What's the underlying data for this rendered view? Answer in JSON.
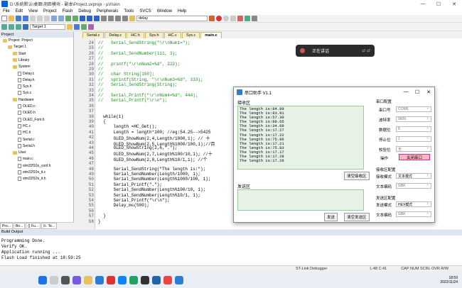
{
  "app": {
    "title": "D:\\系统默认\\桌面\\测距模块 - 副本\\Project.uvprojx - µVision",
    "win_controls": [
      "—",
      "☐",
      "✕"
    ]
  },
  "menu": [
    "File",
    "Edit",
    "View",
    "Project",
    "Flash",
    "Debug",
    "Peripherals",
    "Tools",
    "SVCS",
    "Window",
    "Help"
  ],
  "toolbar": {
    "search_value": "delay",
    "target": "Target 1"
  },
  "project_pane": {
    "header": "Project",
    "tree": [
      {
        "label": "Project: Project",
        "indent": 0,
        "kind": "root"
      },
      {
        "label": "Target 1",
        "indent": 1,
        "kind": "folder"
      },
      {
        "label": "Start",
        "indent": 2,
        "kind": "folder"
      },
      {
        "label": "Library",
        "indent": 2,
        "kind": "folder"
      },
      {
        "label": "System",
        "indent": 2,
        "kind": "folder"
      },
      {
        "label": "Delay.c",
        "indent": 3,
        "kind": "file"
      },
      {
        "label": "Delay.h",
        "indent": 3,
        "kind": "file"
      },
      {
        "label": "Sys.h",
        "indent": 3,
        "kind": "file"
      },
      {
        "label": "Sys.c",
        "indent": 3,
        "kind": "file"
      },
      {
        "label": "Hardware",
        "indent": 2,
        "kind": "folder"
      },
      {
        "label": "OLED.c",
        "indent": 3,
        "kind": "file"
      },
      {
        "label": "OLED.h",
        "indent": 3,
        "kind": "file"
      },
      {
        "label": "OLED_Font.h",
        "indent": 3,
        "kind": "file"
      },
      {
        "label": "HC.c",
        "indent": 3,
        "kind": "file"
      },
      {
        "label": "HC.h",
        "indent": 3,
        "kind": "file"
      },
      {
        "label": "Serial.c",
        "indent": 3,
        "kind": "file"
      },
      {
        "label": "Serial.h",
        "indent": 3,
        "kind": "file"
      },
      {
        "label": "User",
        "indent": 2,
        "kind": "folder"
      },
      {
        "label": "main.c",
        "indent": 3,
        "kind": "file"
      },
      {
        "label": "stm32f10x_conf.h",
        "indent": 3,
        "kind": "file"
      },
      {
        "label": "stm32f10x_it.c",
        "indent": 3,
        "kind": "file"
      },
      {
        "label": "stm32f10x_it.h",
        "indent": 3,
        "kind": "file"
      }
    ],
    "bottom_tabs": [
      "Pro...",
      "Bo...",
      "{} Fu...",
      "0↓ Te..."
    ]
  },
  "editor_tabs": [
    "Serial.c",
    "Delay.c",
    "HC.h",
    "Sys.h",
    "HC.c",
    "Sys.c",
    "main.c"
  ],
  "code": [
    {
      "n": "24",
      "t": "//   Serial_SendString(\"\\r\\nNum1=\");"
    },
    {
      "n": "25",
      "t": "//"
    },
    {
      "n": "26",
      "t": "//   Serial_SendNumber(111, 3);"
    },
    {
      "n": "27",
      "t": "//"
    },
    {
      "n": "28",
      "t": "//   printf(\"\\r\\nNum2=%d\", 222);"
    },
    {
      "n": "29",
      "t": "//"
    },
    {
      "n": "30",
      "t": "//   char String[100];"
    },
    {
      "n": "31",
      "t": "//   sprintf(String, \"\\r\\nNum3=%d\", 333);"
    },
    {
      "n": "32",
      "t": "//   Serial_SendString(String);"
    },
    {
      "n": "33",
      "t": "//"
    },
    {
      "n": "34",
      "t": "//   Serial_Printf(\"\\r\\nNum4=%d\", 444);"
    },
    {
      "n": "35",
      "t": "//   Serial_Printf(\"\\r\\n\");"
    },
    {
      "n": "36",
      "t": ""
    },
    {
      "n": "37",
      "t": ""
    },
    {
      "n": "38",
      "t": "  while(1)"
    },
    {
      "n": "39",
      "t": "  {"
    },
    {
      "n": "40",
      "t": "      length =HC_Get();"
    },
    {
      "n": "41",
      "t": "      Length = length*100; //eg:54.25-->5425"
    },
    {
      "n": "42",
      "t": "      OLED_ShowNum(2,4,Length/1000,1); // 十"
    },
    {
      "n": "43",
      "t": "      OLED_ShowNum(2,5,Length%1000/100,1);//百"
    },
    {
      "n": "44",
      "t": "      OLED_ShowString(2,6,\".\");"
    },
    {
      "n": "45",
      "t": "      OLED_ShowNum(2,7,Length%100/10,1); //十"
    },
    {
      "n": "46",
      "t": "      OLED_ShowNum(2,8,Length%10/1,1); //个"
    },
    {
      "n": "47",
      "t": ""
    },
    {
      "n": "48",
      "t": "      Serial_SendString(\"The length is:\");"
    },
    {
      "n": "49",
      "t": "      Serial_SendNumber(Length/1000, 1);"
    },
    {
      "n": "50",
      "t": "      Serial_SendNumber(Length%1000/100, 1);"
    },
    {
      "n": "51",
      "t": "      Serial_Printf(\".\");"
    },
    {
      "n": "52",
      "t": "      Serial_SendNumber(Length%100/10, 1);"
    },
    {
      "n": "53",
      "t": "      Serial_SendNumber(Length%10/1, 1);"
    },
    {
      "n": "54",
      "t": "      Serial_Printf(\"\\r\\n\");"
    },
    {
      "n": "55",
      "t": "      Delay_ms(500);"
    },
    {
      "n": "56",
      "t": ""
    },
    {
      "n": "57",
      "t": "  }"
    },
    {
      "n": "58",
      "t": "}"
    }
  ],
  "toast": {
    "text": "正在讲话"
  },
  "dialog": {
    "title": "串口助手 V1.1",
    "rx_label": "接收区",
    "tx_label": "发送区",
    "rx_lines": [
      "The length is:84.89",
      "The length is:83.91",
      "The length is:57.30",
      "The length is:89.65",
      "The length is:34.69",
      "The length is:17.27",
      "The length is:17.22",
      "The length is:75.96",
      "The length is:17.21",
      "The length is:75.83",
      "The length is:17.17",
      "The length is:17.28",
      "The length is:17.26"
    ],
    "clear_rx": "清空接收区",
    "send": "发送",
    "clear_tx": "清空发送区",
    "serial_cfg": "串口配置",
    "port_label": "串口号",
    "port_val": "COM5",
    "baud_label": "波特率",
    "baud_val": "9600",
    "data_label": "数据位",
    "data_val": "8",
    "stop_label": "停止位",
    "stop_val": "1",
    "parity_label": "校验位",
    "parity_val": "无",
    "op_label": "操作",
    "close_port": "关闭串口",
    "rx_cfg": "接收区配置",
    "rx_mode_label": "接收模式",
    "rx_mode_val": "文本模式",
    "rx_enc_label": "文本编码",
    "rx_enc_val": "GBK",
    "tx_cfg": "发送区配置",
    "tx_mode_label": "发送模式",
    "tx_mode_val": "HEX模式",
    "tx_enc_label": "文本编码",
    "tx_enc_val": "GBK"
  },
  "build": {
    "header": "Build Output",
    "lines": [
      "Programming Done.",
      "Verify OK.",
      "Application running ...",
      "Flash Load finished at 18:59:25"
    ]
  },
  "status": {
    "debugger": "ST-Link Debugger",
    "pos": "L:48 C:41",
    "caps": "CAP NUM SCRL OVR R/W"
  },
  "taskbar": {
    "time": "18:59",
    "date": "2022/11/24"
  },
  "colors": {
    "code_comment": "#1a8c1a",
    "rx_bg": "#e6f2e6",
    "close_btn": "#f7b7c3"
  }
}
